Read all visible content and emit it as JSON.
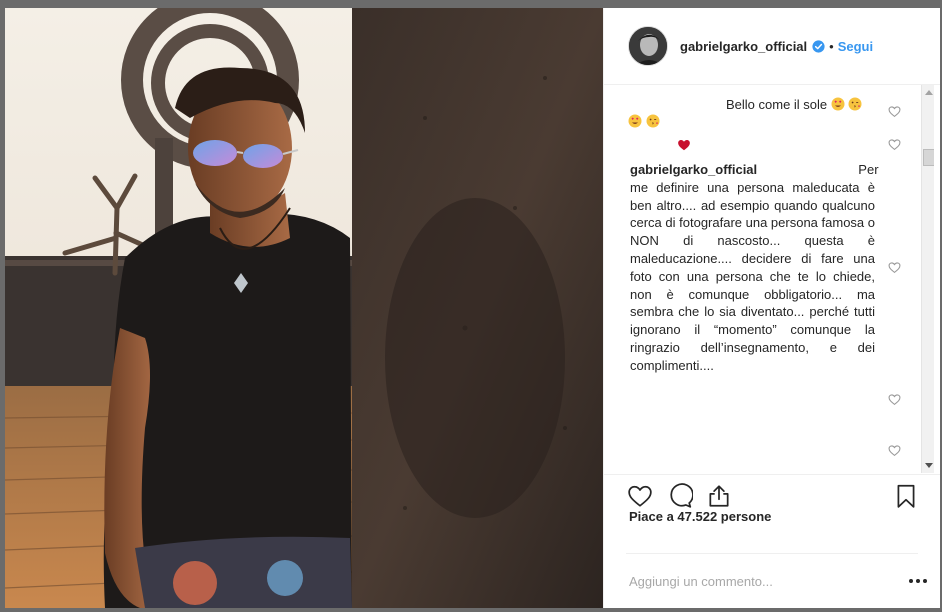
{
  "post": {
    "username": "gabrielgarko_official",
    "separator": "•",
    "follow_label": "Segui",
    "likes_text": "Piace a 47.522 persone"
  },
  "comments": [
    {
      "text": "Bello come il sole",
      "emojis": [
        "heart-eyes-emoji",
        "kiss-emoji"
      ]
    },
    {
      "text": "",
      "emojis": [
        "heart-eyes-emoji",
        "kiss-emoji"
      ]
    },
    {
      "text": "",
      "emojis": [
        "red-heart-emoji"
      ]
    },
    {
      "author": "gabrielgarko_official",
      "text": "Per me definire una persona maleducata è ben altro.... ad esempio quando qualcuno cerca di fotografare una persona famosa o NON di nascosto... questa è maleducazione.... decidere di fare una foto con una persona che te lo chiede, non è comunque obbligatorio... ma sembra che lo sia diventato... perché tutti ignorano il “momento” comunque la ringrazio dell’insegnamento, e dei complimenti...."
    }
  ],
  "add_comment": {
    "placeholder": "Aggiungi un commento..."
  },
  "icons": {
    "like": "heart-outline-icon",
    "comment": "speech-bubble-icon",
    "share": "share-upload-icon",
    "save": "bookmark-icon",
    "more": "more-dots-icon",
    "verified": "verified-badge-icon"
  },
  "colors": {
    "link": "#3897f0",
    "verified": "#3897f0",
    "text": "#262626",
    "placeholder": "#a8a8a8",
    "backdrop": "#6b6b6b"
  }
}
